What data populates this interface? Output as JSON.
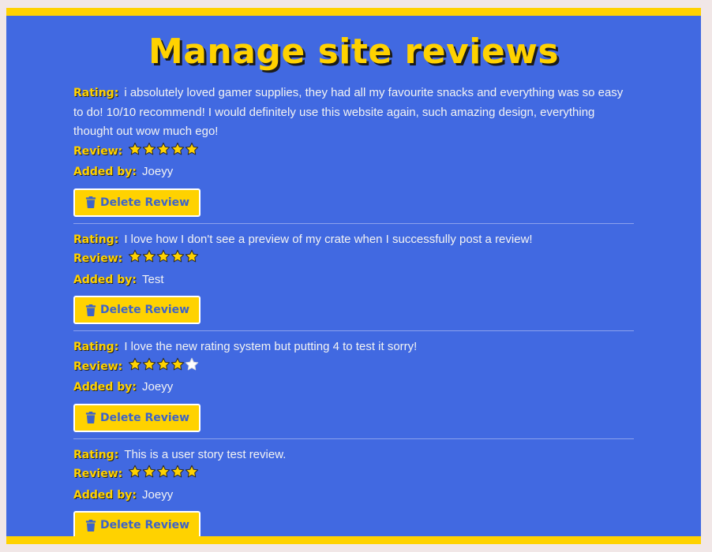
{
  "page": {
    "title": "Manage site reviews"
  },
  "labels": {
    "rating": "Rating:",
    "review": "Review:",
    "added_by": "Added by:",
    "delete": "Delete Review"
  },
  "colors": {
    "accent": "#ffd200",
    "background": "#4169e1",
    "star_filled": "#ffd200",
    "star_empty": "#ffffff"
  },
  "reviews": [
    {
      "text": "i absolutely loved gamer supplies, they had all my favourite snacks and everything was so easy to do! 10/10 recommend! I would definitely use this website again, such amazing design, everything thought out wow much ego!",
      "stars": 5,
      "author": "Joeyy"
    },
    {
      "text": "I love how I don't see a preview of my crate when I successfully post a review!",
      "stars": 5,
      "author": "Test"
    },
    {
      "text": "I love the new rating system but putting 4 to test it sorry!",
      "stars": 4,
      "author": "Joeyy"
    },
    {
      "text": "This is a user story test review.",
      "stars": 5,
      "author": "Joeyy"
    }
  ],
  "icons": {
    "star": "star-icon",
    "delete": "trash-icon"
  }
}
